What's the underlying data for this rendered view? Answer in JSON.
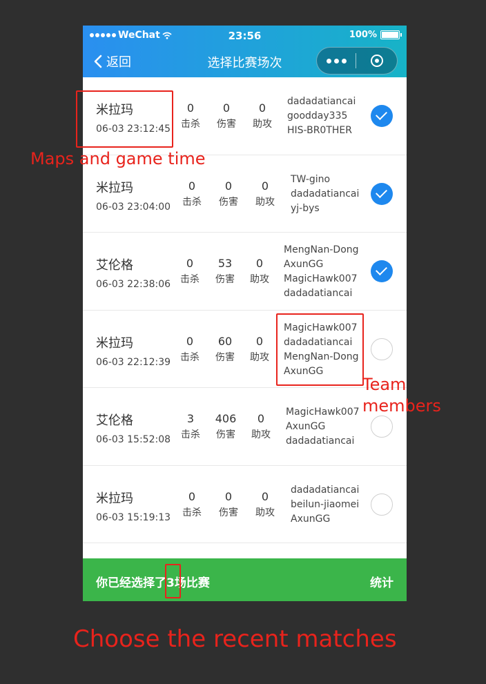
{
  "status_bar": {
    "carrier": "WeChat",
    "time": "23:56",
    "battery": "100%"
  },
  "nav": {
    "back_label": "返回",
    "title": "选择比赛场次"
  },
  "stat_labels": {
    "kills": "击杀",
    "damage": "伤害",
    "assists": "助攻"
  },
  "matches": [
    {
      "map": "米拉玛",
      "time": "06-03 23:12:45",
      "kills": "0",
      "damage": "0",
      "assists": "0",
      "members": [
        "dadadatiancai",
        "goodday335",
        "HIS-BR0THER"
      ],
      "selected": true
    },
    {
      "map": "米拉玛",
      "time": "06-03 23:04:00",
      "kills": "0",
      "damage": "0",
      "assists": "0",
      "members": [
        "TW-gino",
        "dadadatiancai",
        "yj-bys"
      ],
      "selected": true
    },
    {
      "map": "艾伦格",
      "time": "06-03 22:38:06",
      "kills": "0",
      "damage": "53",
      "assists": "0",
      "members": [
        "MengNan-Dong",
        "AxunGG",
        "MagicHawk007",
        "dadadatiancai"
      ],
      "selected": true
    },
    {
      "map": "米拉玛",
      "time": "06-03 22:12:39",
      "kills": "0",
      "damage": "60",
      "assists": "0",
      "members": [
        "MagicHawk007",
        "dadadatiancai",
        "MengNan-Dong",
        "AxunGG"
      ],
      "selected": false
    },
    {
      "map": "艾伦格",
      "time": "06-03 15:52:08",
      "kills": "3",
      "damage": "406",
      "assists": "0",
      "members": [
        "MagicHawk007",
        "AxunGG",
        "dadadatiancai"
      ],
      "selected": false
    },
    {
      "map": "米拉玛",
      "time": "06-03 15:19:13",
      "kills": "0",
      "damage": "0",
      "assists": "0",
      "members": [
        "dadadatiancai",
        "beilun-jiaomei",
        "AxunGG"
      ],
      "selected": false
    }
  ],
  "bottom": {
    "prefix": "你已经选择了",
    "count": "3",
    "suffix": "场比赛",
    "stats_button": "统计"
  },
  "annotations": {
    "maps_time": "Maps and game time",
    "team_members_line1": "Team",
    "team_members_line2": "members",
    "caption": "Choose the recent matches"
  },
  "colors": {
    "accent": "#1e88ee",
    "bottom_bar": "#3bb54a",
    "annotation": "#e8231c"
  }
}
